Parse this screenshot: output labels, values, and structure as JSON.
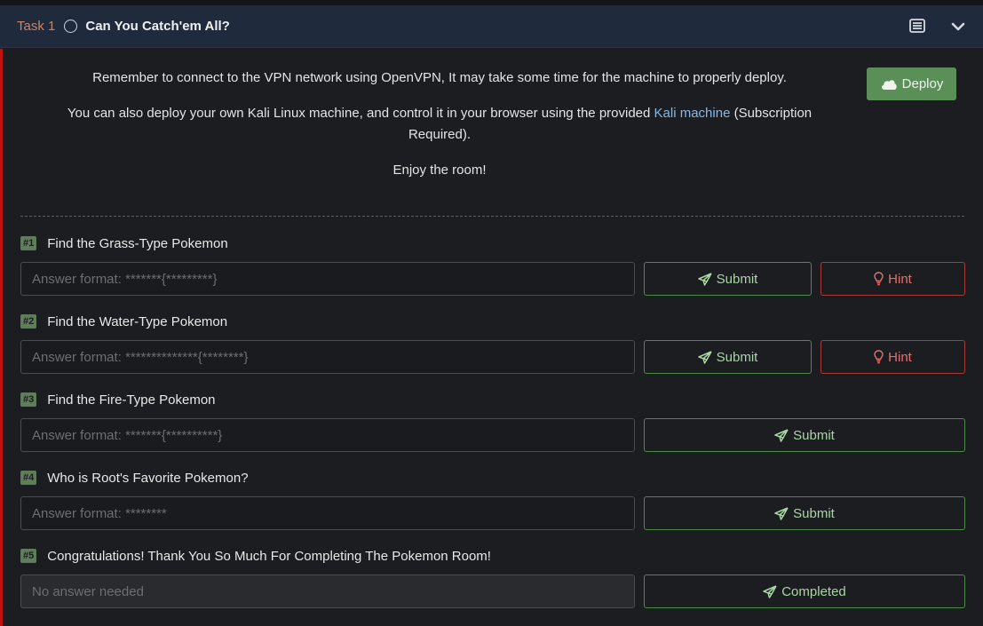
{
  "task": {
    "label": "Task 1",
    "title": "Can You Catch'em All?"
  },
  "info": {
    "line1": "Remember to connect to the VPN network using OpenVPN, It may take some time for the machine to properly deploy.",
    "line2_before": "You can also deploy your own Kali Linux machine, and control it in your browser using the provided ",
    "line2_link": "Kali machine",
    "line2_after": " (Subscription",
    "line2_cont": "Required).",
    "line3": "Enjoy the room!"
  },
  "deploy_label": "Deploy",
  "submit_label": "Submit",
  "hint_label": "Hint",
  "completed_label": "Completed",
  "questions": [
    {
      "num": "#1",
      "text": "Find the Grass-Type Pokemon",
      "placeholder": "Answer format: *******{*********}"
    },
    {
      "num": "#2",
      "text": "Find the Water-Type Pokemon",
      "placeholder": "Answer format: **************{********}"
    },
    {
      "num": "#3",
      "text": "Find the Fire-Type Pokemon",
      "placeholder": "Answer format: *******{**********}"
    },
    {
      "num": "#4",
      "text": "Who is Root's Favorite Pokemon?",
      "placeholder": "Answer format: ********"
    },
    {
      "num": "#5",
      "text": "Congratulations! Thank You So Much For Completing The Pokemon Room!",
      "placeholder": "No answer needed"
    }
  ],
  "colors": {
    "header_bg": "#1f2a3d",
    "accent_red": "#c11111",
    "submit_green": "#4d8b4a",
    "hint_red": "#a83b3b",
    "deploy_green": "#5a8f57",
    "badge_green": "#5f7d59"
  },
  "icons": {
    "header_right": [
      "notes-icon",
      "chevron-down-icon"
    ],
    "deploy": "cloud-icon",
    "submit": "paper-plane-icon",
    "hint": "lightbulb-icon"
  }
}
